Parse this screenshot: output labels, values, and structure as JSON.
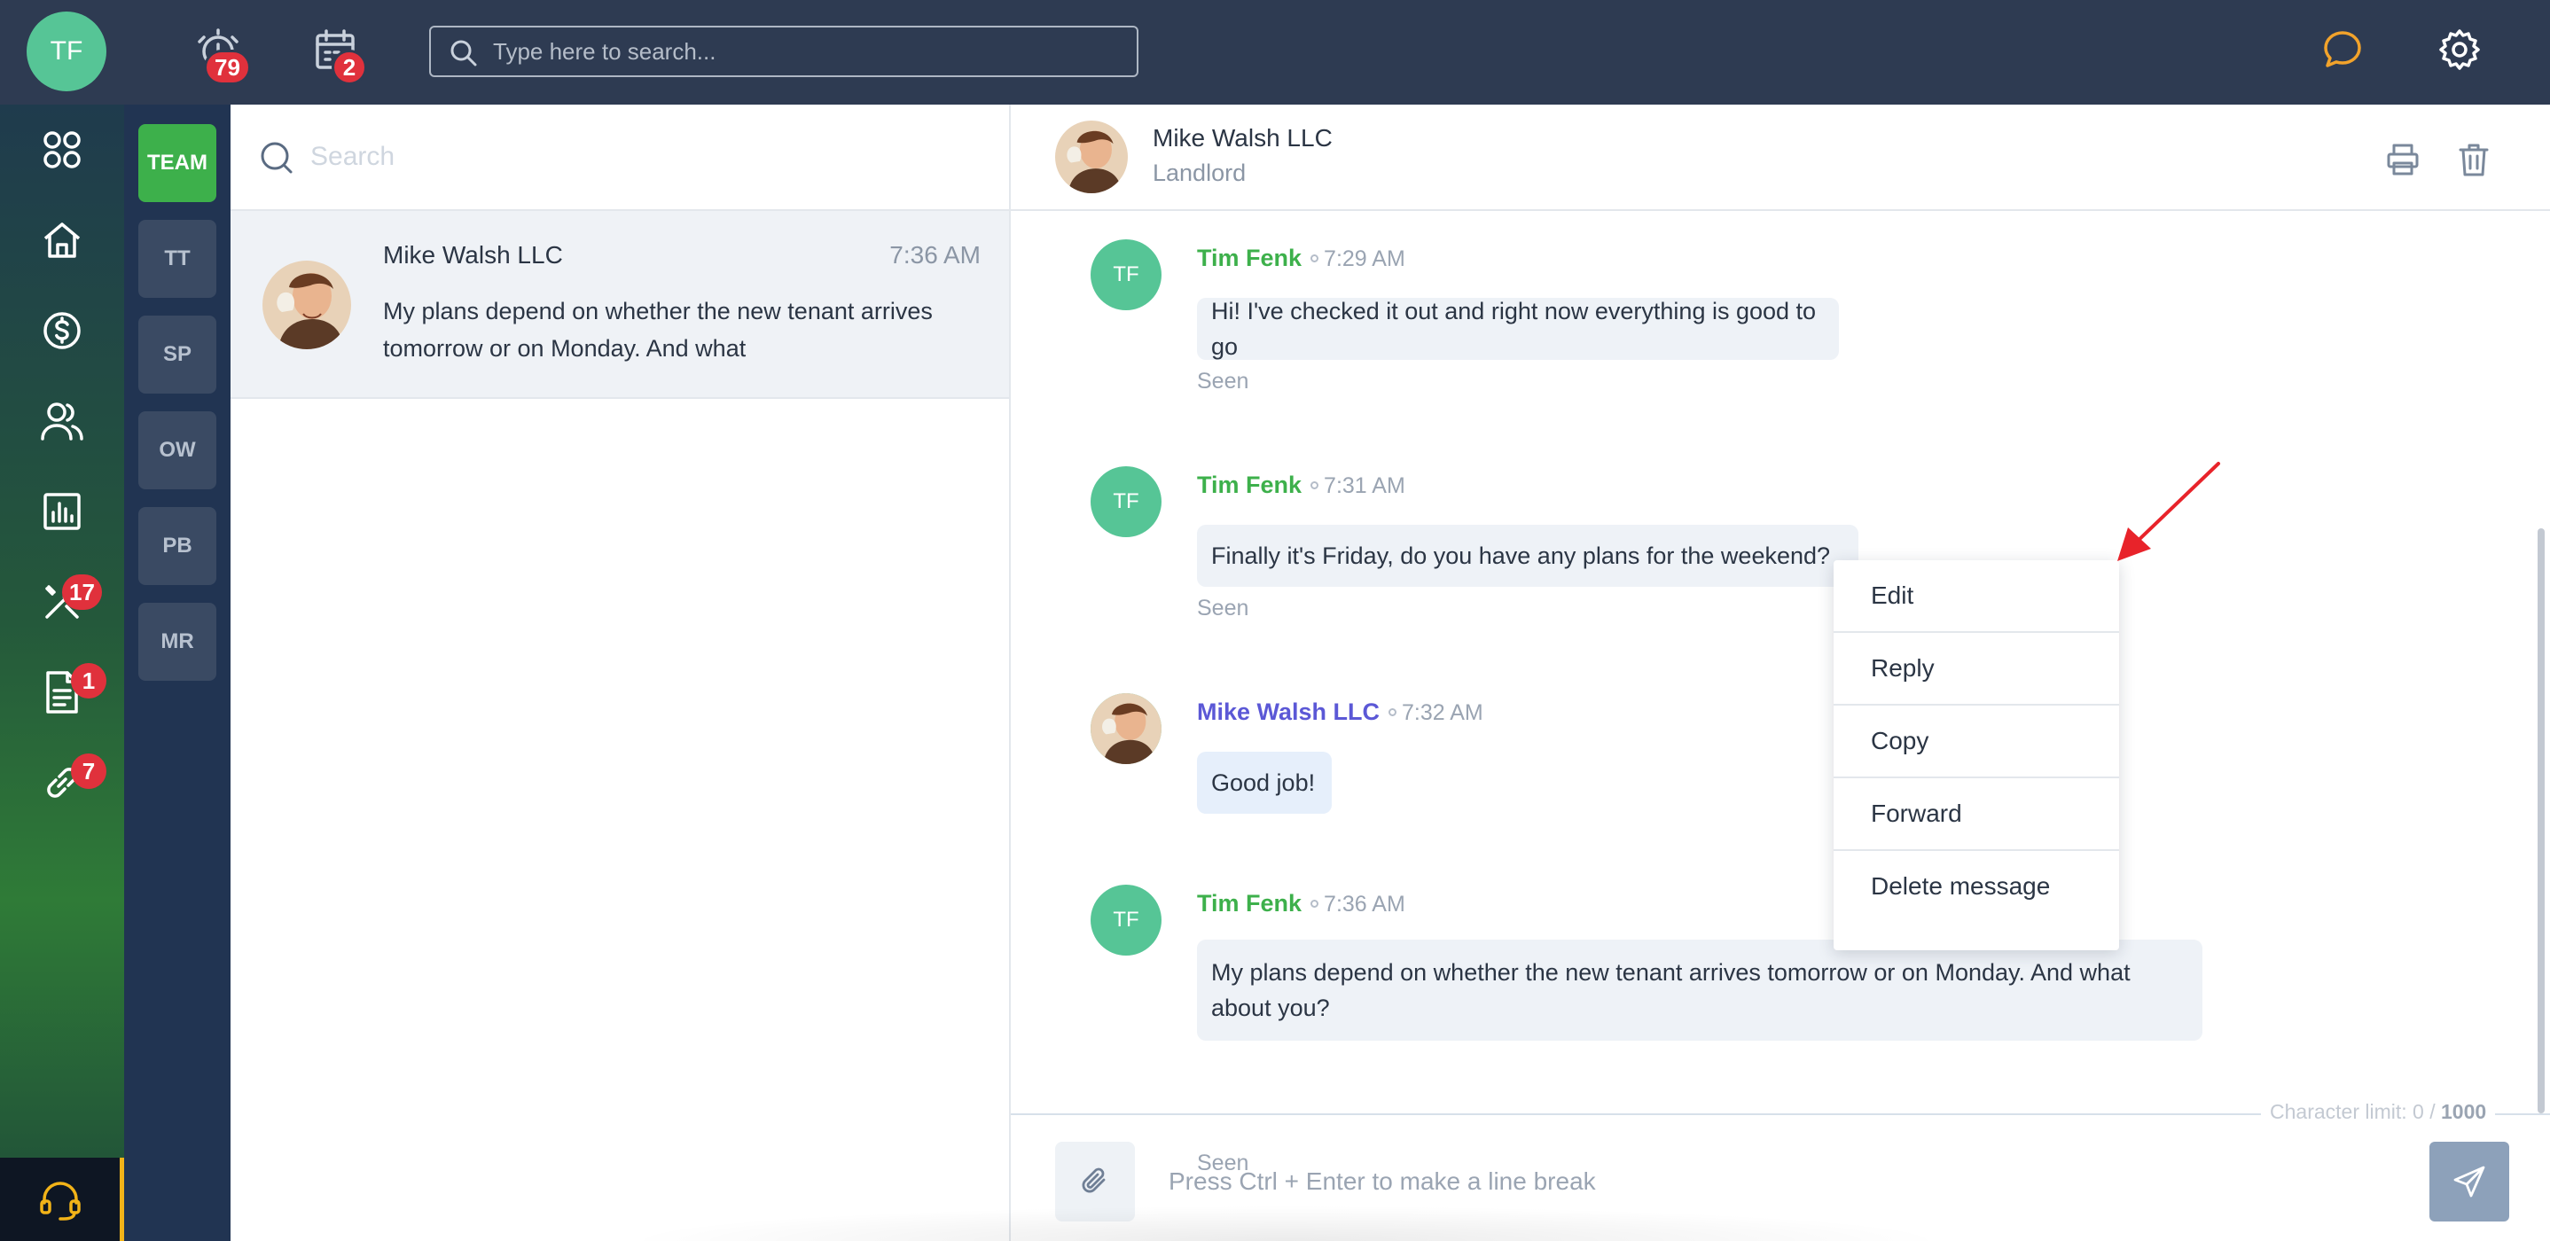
{
  "topbar": {
    "user_initials": "TF",
    "alarm_badge": "79",
    "calendar_badge": "2",
    "search_placeholder": "Type here to search..."
  },
  "leftnav": {
    "maintenance_badge": "17",
    "documents_badge": "1",
    "links_badge": "7"
  },
  "teams": [
    "TEAM",
    "TT",
    "SP",
    "OW",
    "PB",
    "MR"
  ],
  "conversations": {
    "search_placeholder": "Search",
    "items": [
      {
        "name": "Mike Walsh LLC",
        "time": "7:36 AM",
        "preview": "My plans depend on whether the new tenant arrives tomorrow or on Monday. And what"
      }
    ]
  },
  "chat": {
    "contact_name": "Mike Walsh LLC",
    "contact_role": "Landlord",
    "messages": [
      {
        "sender": "Tim Fenk",
        "initials": "TF",
        "time": "7:29 AM",
        "text": "Hi! I've checked it out and right now everything is good to go",
        "status": "Seen"
      },
      {
        "sender": "Tim Fenk",
        "initials": "TF",
        "time": "7:31 AM",
        "text": "Finally it's Friday, do you have any plans for the weekend?",
        "status": "Seen"
      },
      {
        "sender": "Mike Walsh LLC",
        "initials": "",
        "time": "7:32 AM",
        "text": "Good job!",
        "status": ""
      },
      {
        "sender": "Tim Fenk",
        "initials": "TF",
        "time": "7:36 AM",
        "text_line1": "My plans depend on whether the new tenant arrives tomorrow or on Monday. And what",
        "text_line2": "about you?",
        "status": "Seen"
      }
    ],
    "context_menu": [
      "Edit",
      "Reply",
      "Copy",
      "Forward",
      "Delete message"
    ],
    "char_limit_label": "Character limit: 0 / ",
    "char_limit_max": "1000",
    "compose_placeholder": "Press Ctrl + Enter to make a line break"
  },
  "colors": {
    "topbar": "#2e3b52",
    "accent_green": "#3db04b",
    "avatar_green": "#56c596",
    "badge_red": "#e0313c",
    "landlord_purple": "#5b58d6",
    "annotation_arrow": "#e8232a"
  }
}
